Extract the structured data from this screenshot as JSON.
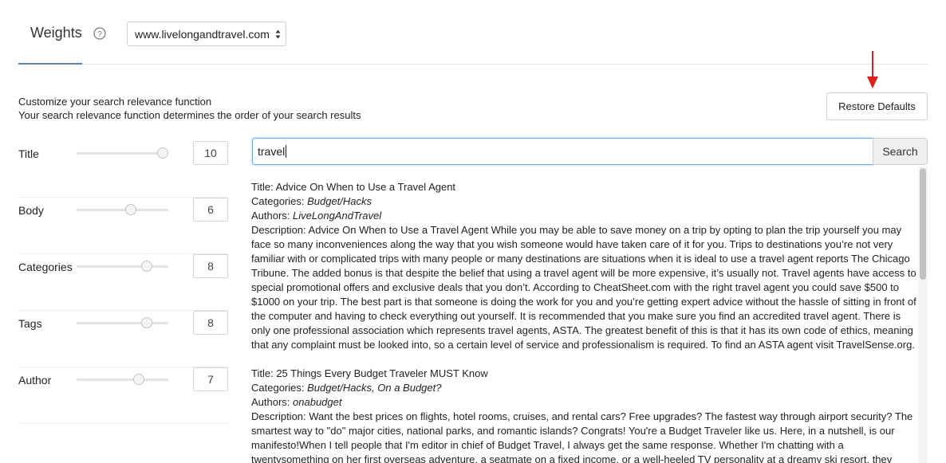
{
  "header": {
    "title": "Weights",
    "help_icon": "question-circle-icon",
    "site_selector": {
      "selected": "www.livelongandtravel.com"
    },
    "active_tab_color": "#5a7fa8"
  },
  "description": {
    "line1": "Customize your search relevance function",
    "line2": "Your search relevance function determines the order of your search results"
  },
  "restore_button": {
    "label": "Restore Defaults"
  },
  "annotation_color": "#e02020",
  "weights": [
    {
      "label": "Title",
      "value": "10",
      "level": 1.0
    },
    {
      "label": "Body",
      "value": "6",
      "level": 0.6
    },
    {
      "label": "Categories",
      "value": "8",
      "level": 0.8
    },
    {
      "label": "Tags",
      "value": "8",
      "level": 0.8
    },
    {
      "label": "Author",
      "value": "7",
      "level": 0.7
    }
  ],
  "search": {
    "value": "travel",
    "button_label": "Search",
    "focus_color": "#66afe9"
  },
  "results": [
    {
      "title_prefix": "Title: ",
      "title": "Advice On When to Use a Travel Agent",
      "categories_prefix": "Categories: ",
      "categories": "Budget/Hacks",
      "authors_prefix": "Authors: ",
      "authors": "LiveLongAndTravel",
      "description_prefix": "Description: ",
      "description": "Advice On When to Use a Travel Agent While you may be able to save money on a trip by opting to plan the trip yourself you may face so many inconveniences along the way that you wish someone would have taken care of it for you. Trips to destinations you’re not very familiar with or complicated trips with many people or many destinations are situations when it is ideal to use a travel agent reports The Chicago Tribune. The added bonus is that despite the belief that using a travel agent will be more expensive, it’s usually not. Travel agents have access to special promotional offers and exclusive deals that you don’t. According to CheatSheet.com with the right travel agent you could save $500 to $1000 on your trip.  The best part is that someone is doing the work for you and you’re getting expert advice without the hassle of sitting in front of the computer and having to check everything out yourself. It is recommended that you make sure you find an accredited travel agent. There is only one professional association which represents travel agents, ASTA. The greatest benefit of this is that it has its own code of ethics, meaning that any complaint must be looked into, so a certain level of service and professionalism is required. To find an ASTA agent visit TravelSense.org."
    },
    {
      "title_prefix": "Title: ",
      "title": "25 Things Every Budget Traveler MUST Know",
      "categories_prefix": "Categories: ",
      "categories": "Budget/Hacks, On a Budget?",
      "authors_prefix": "Authors: ",
      "authors": "onabudget",
      "description_prefix": "Description: ",
      "description": "Want the best prices on flights, hotel rooms, cruises, and rental cars? Free upgrades? The fastest way through airport security? The smartest way to \"do\" major cities, national parks, and romantic islands? Congrats! You're a Budget Traveler like us. Here, in a nutshell, is our manifesto!When I tell people that I'm editor in chief of Budget Travel, I always get the same response. Whether I'm chatting with a twentysomething on her first overseas adventure, a seatmate on a fixed income, or a well-heeled TV personality at a dreamy ski resort, they invariably reply, \"Cool."
    }
  ]
}
